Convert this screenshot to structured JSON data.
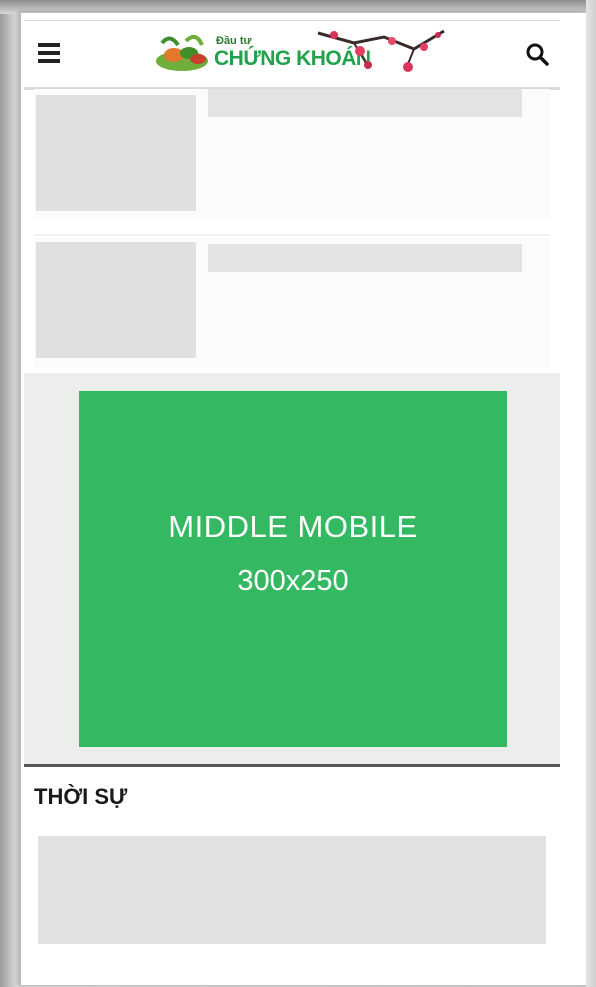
{
  "header": {
    "menu_icon": "hamburger-menu-icon",
    "logo_small_text": "Đầu tư",
    "logo_main_text": "CHỨNG KHOÁN",
    "search_icon": "search-icon"
  },
  "articles": [
    {
      "thumbnail": "placeholder",
      "title": ""
    },
    {
      "thumbnail": "placeholder",
      "title": ""
    }
  ],
  "ad": {
    "line1": "MIDDLE MOBILE",
    "line2": "300x250",
    "color": "#34b862"
  },
  "section": {
    "title": "THỜI SỰ"
  }
}
